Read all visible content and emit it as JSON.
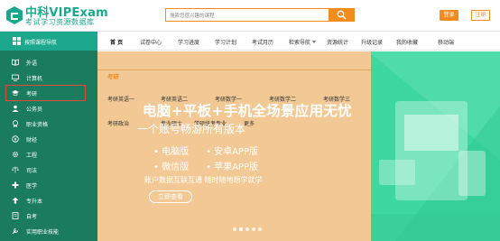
{
  "header": {
    "logo_title": "中科VIPExam",
    "logo_sub": "考试学习资源数据库",
    "search_placeholder": "搜索您感兴趣的课程",
    "login": "登录",
    "register": "注册"
  },
  "nav": {
    "items": [
      "首 页",
      "试卷中心",
      "学习进度",
      "学习计划",
      "考试月历",
      "检索导航",
      "资源统计",
      "升级记录",
      "我的收藏",
      "移动端"
    ]
  },
  "sidebar": {
    "header": "按照课程导航",
    "items": [
      {
        "label": "外语",
        "icon": "book-icon"
      },
      {
        "label": "计算机",
        "icon": "monitor-icon"
      },
      {
        "label": "考研",
        "icon": "graduation-icon"
      },
      {
        "label": "公务员",
        "icon": "person-icon"
      },
      {
        "label": "职业资格",
        "icon": "badge-icon"
      },
      {
        "label": "财经",
        "icon": "coin-icon"
      },
      {
        "label": "工程",
        "icon": "gear-icon"
      },
      {
        "label": "司法",
        "icon": "scale-icon"
      },
      {
        "label": "医学",
        "icon": "medical-icon"
      },
      {
        "label": "专升本",
        "icon": "upgrade-icon"
      },
      {
        "label": "自考",
        "icon": "book-open-icon"
      },
      {
        "label": "实用职业技能",
        "icon": "tool-icon"
      }
    ]
  },
  "panel": {
    "title": "考研",
    "row1": [
      "考研英语一",
      "考研英语二",
      "考研数学一",
      "考研数学二",
      "考研数学三"
    ],
    "row2": [
      "考研政治",
      "专业硕士",
      "学硕统考专业",
      "更多"
    ]
  },
  "banner": {
    "headline": "电脑+平板+手机全场景应用无忧",
    "subline": "一个账号畅游所有版本",
    "features": [
      "电脑版",
      "安卓APP版",
      "微信版",
      "苹果APP版"
    ],
    "note": "账户数据互联互通 随时随地想学就学",
    "cta": "立即查看"
  },
  "colors": {
    "accent": "#f28c1d",
    "sidebar": "#1b7b5e",
    "sidebar_head": "#1ba88c",
    "banner": "#3fd7a0",
    "highlight": "#e04a3a"
  }
}
